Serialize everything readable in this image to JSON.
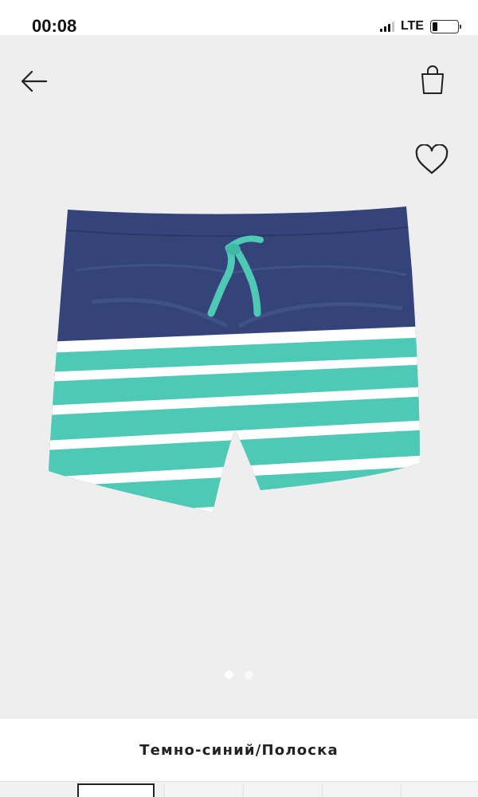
{
  "status_bar": {
    "time": "00:08",
    "network": "LTE",
    "battery_level": 0.2
  },
  "header": {
    "back_icon": "arrow-left-icon",
    "bag_icon": "shopping-bag-icon"
  },
  "gallery": {
    "favorite_icon": "heart-outline-icon",
    "image_count": 2,
    "active_index": 0,
    "background": "#eeeeee"
  },
  "product": {
    "color_name": "Темно-синий/Полоска",
    "colors": {
      "navy": "#34447a",
      "turquoise": "#4ec9b6",
      "stripe": "#ffffff"
    }
  }
}
